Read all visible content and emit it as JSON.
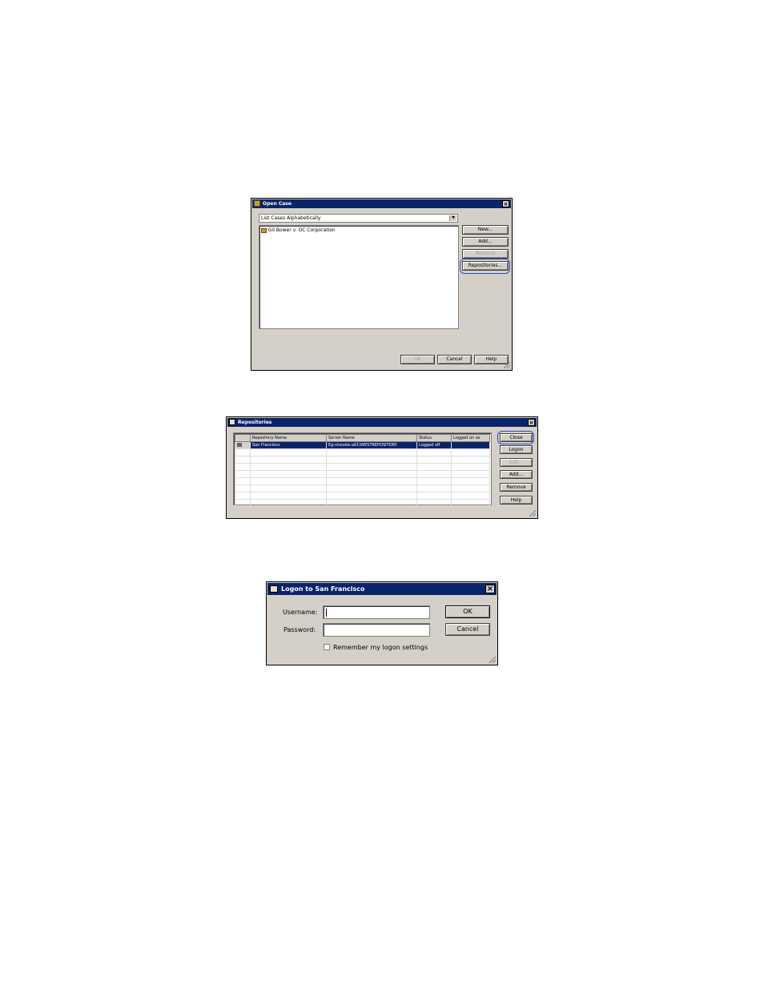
{
  "open_case": {
    "title": "Open Case",
    "sort_select": "List Cases Alphabetically",
    "cases": [
      "Gil Bower v. OC Corporation"
    ],
    "buttons": {
      "new": "New...",
      "add": "Add...",
      "remove": "Remove",
      "repositories": "Repositories..."
    },
    "footer": {
      "ok": "OK",
      "cancel": "Cancel",
      "help": "Help"
    }
  },
  "repositories": {
    "title": "Repositories",
    "columns": [
      "Repository Name",
      "Server Name",
      "Status",
      "Logged on as"
    ],
    "rows": [
      {
        "name": "San Francisco",
        "server": "Eg-ntsnote-a01\\WESTREPOSITORY",
        "status": "Logged off",
        "user": ""
      }
    ],
    "buttons": {
      "close": "Close",
      "logon": "Logon",
      "edit": "Edit...",
      "add": "Add...",
      "remove": "Remove",
      "help": "Help"
    }
  },
  "logon": {
    "title": "Logon to San Francisco",
    "username_label": "Username:",
    "password_label": "Password:",
    "username_value": "",
    "password_value": "",
    "remember_label": "Remember my logon settings",
    "ok": "OK",
    "cancel": "Cancel"
  },
  "colors": {
    "titlebar": "#0a246a",
    "dialog_bg": "#d4d0c8",
    "highlight": "#3344cc"
  },
  "icons": [
    "case-folder-icon",
    "close-icon",
    "repository-icon",
    "logon-icon"
  ]
}
